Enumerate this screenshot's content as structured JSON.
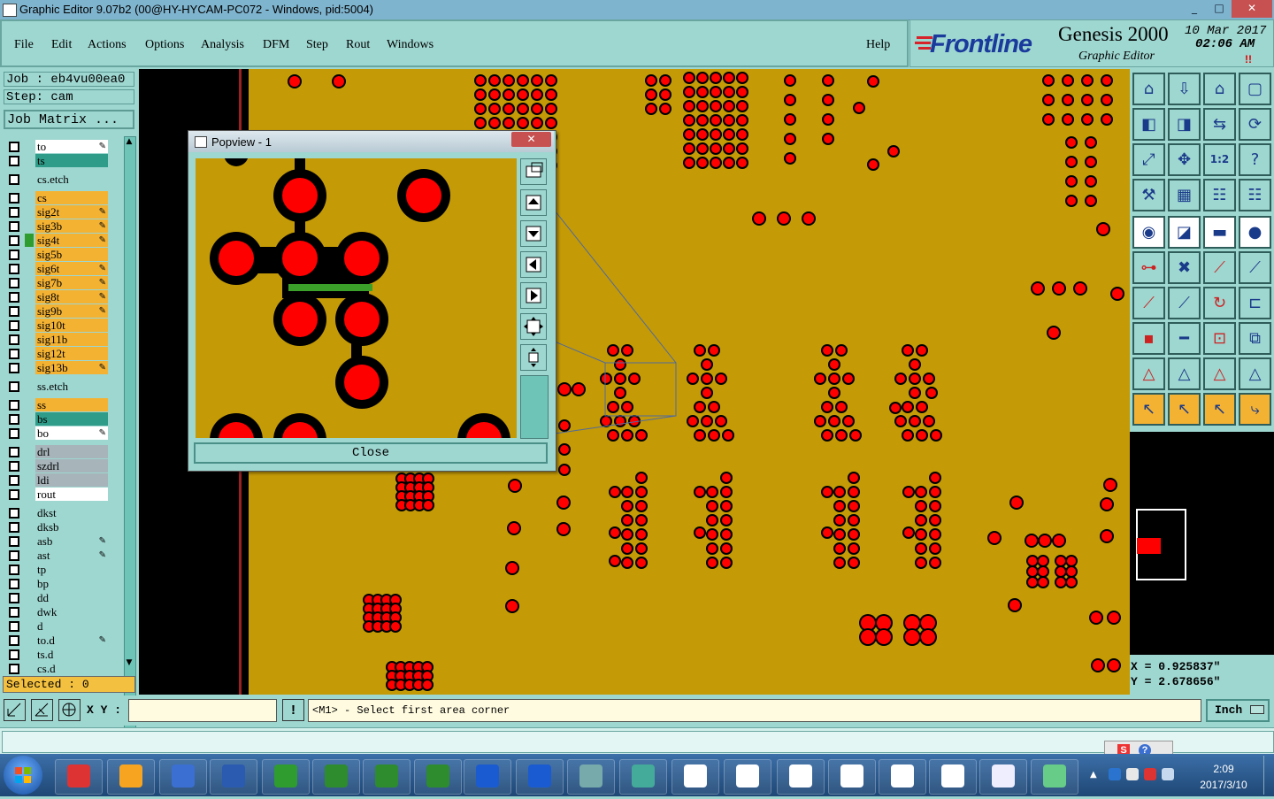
{
  "window": {
    "title": "Graphic Editor 9.07b2 (00@HY-HYCAM-PC072 - Windows, pid:5004)",
    "min": "_",
    "max": "□",
    "close": "✕"
  },
  "menu": {
    "items": [
      "File",
      "Edit",
      "Actions",
      "Options",
      "Analysis",
      "DFM",
      "Step",
      "Rout",
      "Windows"
    ],
    "help": "Help"
  },
  "brand": {
    "logo": "Frontline",
    "product": "Genesis 2000",
    "subtitle": "Graphic Editor",
    "date": "10 Mar 2017",
    "time": "02:06 AM",
    "alert": "!!"
  },
  "job": {
    "job": "Job : eb4vu00ea0",
    "step": "Step: cam",
    "matrix_button": "Job Matrix ..."
  },
  "layers": [
    {
      "name": "to",
      "color": "#ffffff",
      "edit": "✎",
      "group": 0
    },
    {
      "name": "ts",
      "color": "#2e9c88",
      "edit": "",
      "group": 0
    },
    {
      "name": "cs.etch",
      "color": "#9ed6d0",
      "edit": "",
      "group": 1
    },
    {
      "name": "cs",
      "color": "#f4b233",
      "edit": "",
      "group": 2
    },
    {
      "name": "sig2t",
      "color": "#f4b233",
      "edit": "✎",
      "group": 2
    },
    {
      "name": "sig3b",
      "color": "#f4b233",
      "edit": "✎",
      "group": 2
    },
    {
      "name": "sig4t",
      "color": "#f4b233",
      "edit": "✎",
      "group": 2,
      "marker": true
    },
    {
      "name": "sig5b",
      "color": "#f4b233",
      "edit": "",
      "group": 2
    },
    {
      "name": "sig6t",
      "color": "#f4b233",
      "edit": "✎",
      "group": 2
    },
    {
      "name": "sig7b",
      "color": "#f4b233",
      "edit": "✎",
      "group": 2
    },
    {
      "name": "sig8t",
      "color": "#f4b233",
      "edit": "✎",
      "group": 2
    },
    {
      "name": "sig9b",
      "color": "#f4b233",
      "edit": "✎",
      "group": 2
    },
    {
      "name": "sig10t",
      "color": "#f4b233",
      "edit": "",
      "group": 2
    },
    {
      "name": "sig11b",
      "color": "#f4b233",
      "edit": "",
      "group": 2
    },
    {
      "name": "sig12t",
      "color": "#f4b233",
      "edit": "",
      "group": 2
    },
    {
      "name": "sig13b",
      "color": "#f4b233",
      "edit": "✎",
      "group": 2
    },
    {
      "name": "ss.etch",
      "color": "#9ed6d0",
      "edit": "",
      "group": 3
    },
    {
      "name": "ss",
      "color": "#f4b233",
      "edit": "",
      "group": 4
    },
    {
      "name": "bs",
      "color": "#2e9c88",
      "edit": "",
      "group": 4
    },
    {
      "name": "bo",
      "color": "#ffffff",
      "edit": "✎",
      "group": 4
    },
    {
      "name": "drl",
      "color": "#a7b4ba",
      "edit": "",
      "group": 5
    },
    {
      "name": "szdrl",
      "color": "#a7b4ba",
      "edit": "",
      "group": 5
    },
    {
      "name": "ldi",
      "color": "#a7b4ba",
      "edit": "",
      "group": 5
    },
    {
      "name": "rout",
      "color": "#ffffff",
      "edit": "",
      "group": 5
    },
    {
      "name": "dkst",
      "color": "#9ed6d0",
      "edit": "",
      "group": 6
    },
    {
      "name": "dksb",
      "color": "#9ed6d0",
      "edit": "",
      "group": 6
    },
    {
      "name": "asb",
      "color": "#9ed6d0",
      "edit": "✎",
      "group": 6
    },
    {
      "name": "ast",
      "color": "#9ed6d0",
      "edit": "✎",
      "group": 6
    },
    {
      "name": "tp",
      "color": "#9ed6d0",
      "edit": "",
      "group": 6
    },
    {
      "name": "bp",
      "color": "#9ed6d0",
      "edit": "",
      "group": 6
    },
    {
      "name": "dd",
      "color": "#9ed6d0",
      "edit": "",
      "group": 6
    },
    {
      "name": "dwk",
      "color": "#9ed6d0",
      "edit": "",
      "group": 6
    },
    {
      "name": "d",
      "color": "#9ed6d0",
      "edit": "",
      "group": 6
    },
    {
      "name": "to.d",
      "color": "#9ed6d0",
      "edit": "✎",
      "group": 6
    },
    {
      "name": "ts.d",
      "color": "#9ed6d0",
      "edit": "",
      "group": 6
    },
    {
      "name": "cs.d",
      "color": "#9ed6d0",
      "edit": "",
      "group": 6
    }
  ],
  "selected": "Selected : 0",
  "popview": {
    "title": "Popview - 1",
    "close_label": "Close",
    "close_x": "✕"
  },
  "coords": {
    "x": "X = 0.925837\"",
    "y": "Y = 2.678656\""
  },
  "command": {
    "xy_label": "X Y :",
    "xy_value": "",
    "bang": "!",
    "prompt": "<M1> - Select first area corner",
    "units": "Inch"
  },
  "toolbar_icons": [
    "view-home-icon",
    "view-down-icon",
    "house-icon",
    "zoom-window-icon",
    "pan-left-icon",
    "pan-right-icon",
    "swap-icon",
    "redraw-icon",
    "zoom-fit-icon",
    "zoom-in-icon",
    "scale-1-2-icon",
    "help-query-icon",
    "measure-tool-icon",
    "grid-icon",
    "layers-display-icon",
    "layers-compare-icon",
    "pad-select-icon",
    "feature-color-icon",
    "ruler-icon",
    "pad-dot-icon",
    "connect-nodes-icon",
    "cross-delete-icon",
    "line-node-icon",
    "arc-node-icon",
    "line-red-icon",
    "line-blue-icon",
    "rotate-icon",
    "mirror-f-icon",
    "move-pad-icon",
    "line-hyphen-icon",
    "center-icon",
    "copy-pad-icon",
    "triangle-red-icon",
    "triangle-outline-icon",
    "triangle-solid-icon",
    "triangle-base-icon",
    "pointer-icon",
    "pointer-box-icon",
    "pointer-circle-icon",
    "route-pointer-icon"
  ],
  "taskbar": {
    "time": "2:09",
    "date": "2017/3/10",
    "apps": [
      "start-orb-icon",
      "genesis-app-icon",
      "shell-app-icon",
      "document-app-icon",
      "save-app-icon",
      "frontline-app-icon",
      "excel-app-1-icon",
      "excel-app-2-icon",
      "excel-app-3-icon",
      "frontline-app-2-icon",
      "frontline-app-3-icon",
      "picture-app-icon",
      "network-app-icon",
      "editor-window-1-icon",
      "editor-window-2-icon",
      "editor-window-3-icon",
      "editor-window-4-icon",
      "editor-window-5-icon",
      "editor-window-6-icon",
      "text-doc-icon",
      "print-app-icon"
    ]
  }
}
